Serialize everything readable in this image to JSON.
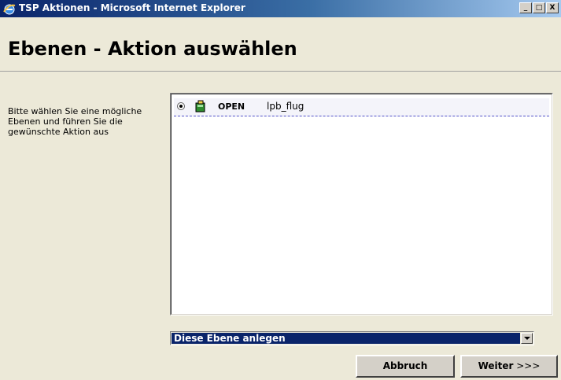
{
  "window": {
    "title": "TSP Aktionen - Microsoft Internet Explorer",
    "controls": [
      "_",
      "□",
      "X"
    ]
  },
  "page": {
    "title": "Ebenen - Aktion auswählen",
    "instruction": "Bitte wählen Sie eine mögliche Ebenen und führen Sie die gewünschte Aktion aus"
  },
  "layers": [
    {
      "selected": true,
      "icon": "layer-icon",
      "status": "OPEN",
      "name": "lpb_flug"
    }
  ],
  "action_select": {
    "value": "Diese Ebene anlegen"
  },
  "buttons": {
    "cancel": "Abbruch",
    "next_word": "Weiter",
    "next_arrows": ">>>"
  },
  "colors": {
    "titlebar_start": "#0a246a",
    "selection": "#0a246a",
    "window_bg": "#ece9d8",
    "row_divider": "#5050c8"
  }
}
